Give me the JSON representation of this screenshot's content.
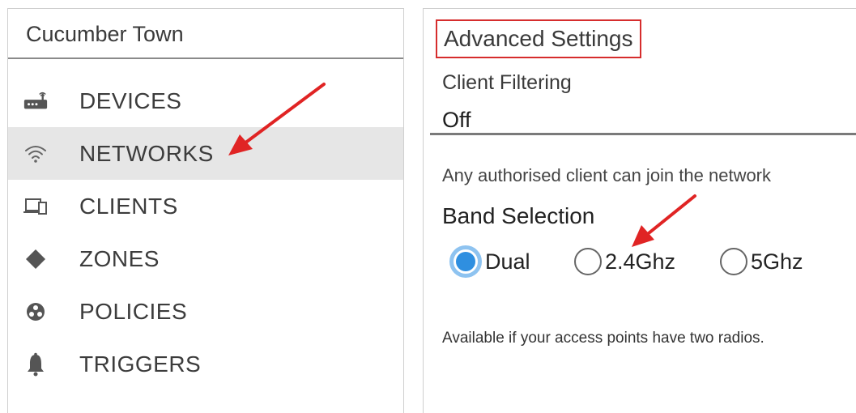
{
  "sidebar": {
    "title": "Cucumber Town",
    "items": [
      {
        "label": "DEVICES",
        "icon": "router-icon",
        "active": false
      },
      {
        "label": "NETWORKS",
        "icon": "wifi-icon",
        "active": true
      },
      {
        "label": "CLIENTS",
        "icon": "devices-icon",
        "active": false
      },
      {
        "label": "ZONES",
        "icon": "diamond-icon",
        "active": false
      },
      {
        "label": "POLICIES",
        "icon": "policy-icon",
        "active": false
      },
      {
        "label": "TRIGGERS",
        "icon": "bell-icon",
        "active": false
      }
    ]
  },
  "main": {
    "section_title": "Advanced Settings",
    "client_filtering": {
      "label": "Client Filtering",
      "value": "Off",
      "description": "Any authorised client can join the network"
    },
    "band_selection": {
      "label": "Band Selection",
      "options": [
        {
          "label": "Dual",
          "selected": true
        },
        {
          "label": "2.4Ghz",
          "selected": false
        },
        {
          "label": "5Ghz",
          "selected": false
        }
      ],
      "note": "Available if your access points have two radios."
    }
  },
  "colors": {
    "highlight_border": "#d62d2d",
    "annotation_arrow": "#e02424",
    "radio_selected": "#2f8fe0",
    "active_row_bg": "#e6e6e6"
  }
}
